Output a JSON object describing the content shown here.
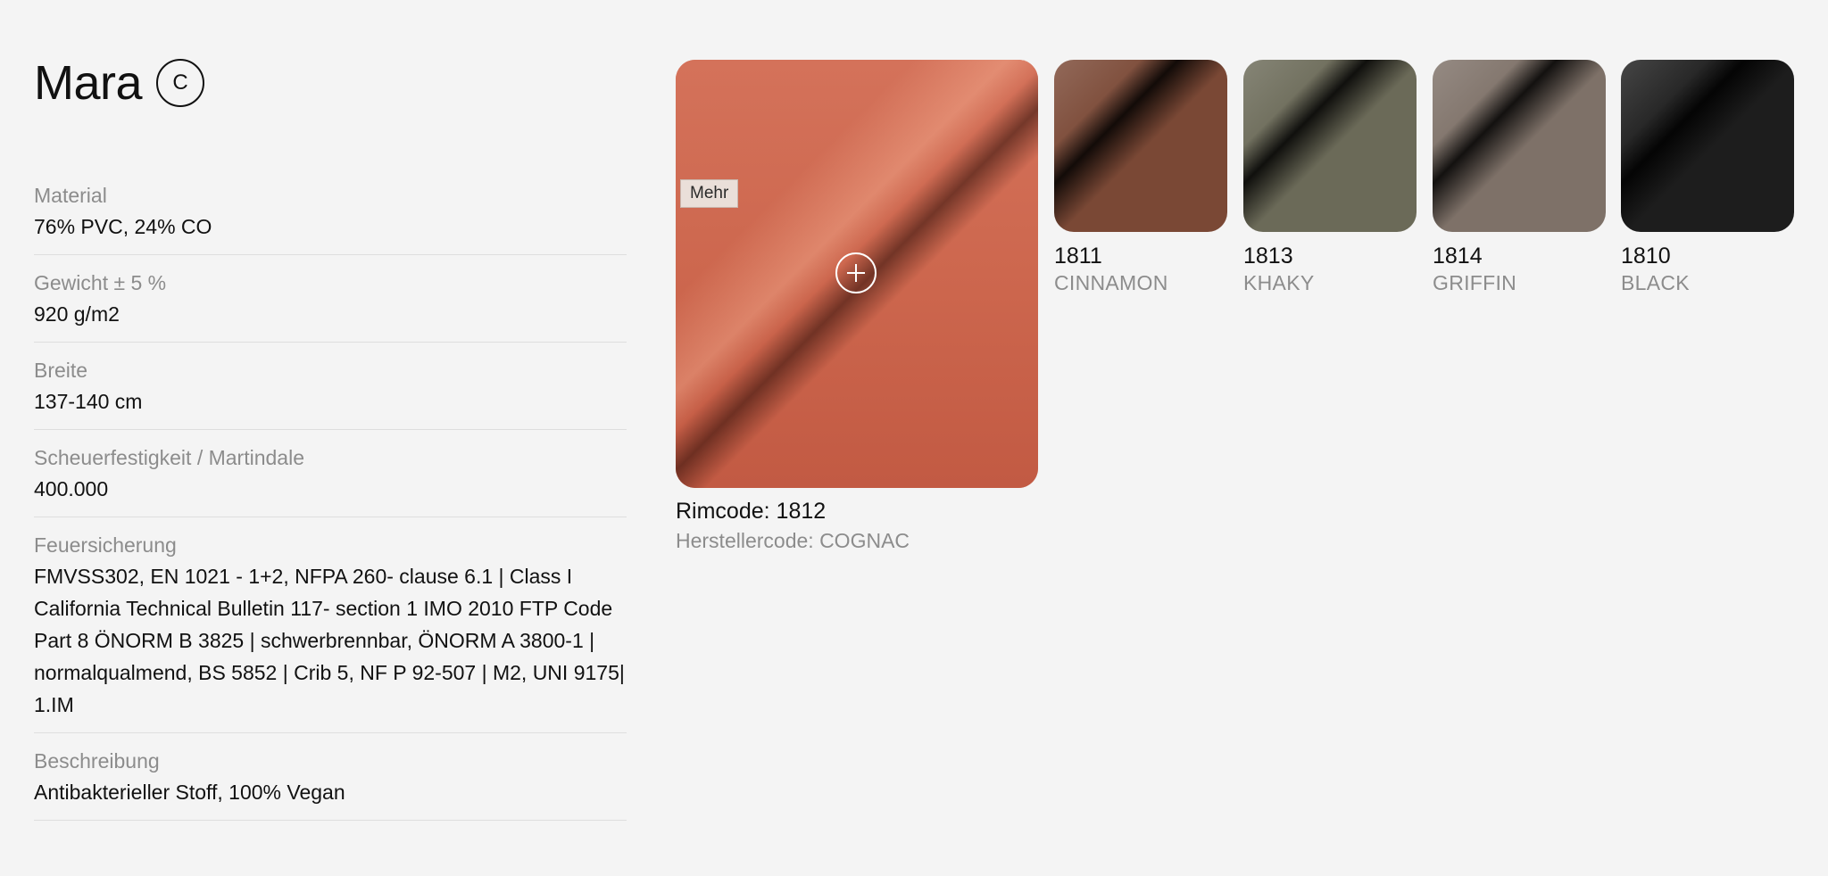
{
  "product": {
    "title": "Mara",
    "badge": "C"
  },
  "specs": [
    {
      "label": "Material",
      "value": "76% PVC, 24% CO"
    },
    {
      "label": "Gewicht ± 5 %",
      "value": "920 g/m2"
    },
    {
      "label": "Breite",
      "value": "137-140 cm"
    },
    {
      "label": "Scheuerfestigkeit / Martindale",
      "value": "400.000"
    },
    {
      "label": "Feuersicherung",
      "value": "FMVSS302, EN 1021 - 1+2, NFPA 260- clause 6.1 | Class I California Technical Bulletin 117- section 1 IMO 2010 FTP Code Part 8 ÖNORM B 3825 | schwerbrennbar, ÖNORM A 3800-1 | normalqualmend, BS 5852 | Crib 5, NF P 92-507 | M2, UNI 9175| 1.IM"
    },
    {
      "label": "Beschreibung",
      "value": "Antibakterieller Stoff, 100% Vegan"
    }
  ],
  "selected": {
    "more_label": "Mehr",
    "rimcode": "Rimcode: 1812",
    "herstellercode": "Herstellercode: COGNAC",
    "color": "#cc6b52",
    "zoom_icon": "plus-circle-icon"
  },
  "variants": [
    {
      "code": "1811",
      "name": "CINNAMON",
      "color": "#7a4835"
    },
    {
      "code": "1813",
      "name": "KHAKY",
      "color": "#6b6a58"
    },
    {
      "code": "1814",
      "name": "GRIFFIN",
      "color": "#7e7168"
    },
    {
      "code": "1810",
      "name": "BLACK",
      "color": "#1d1d1d"
    }
  ]
}
